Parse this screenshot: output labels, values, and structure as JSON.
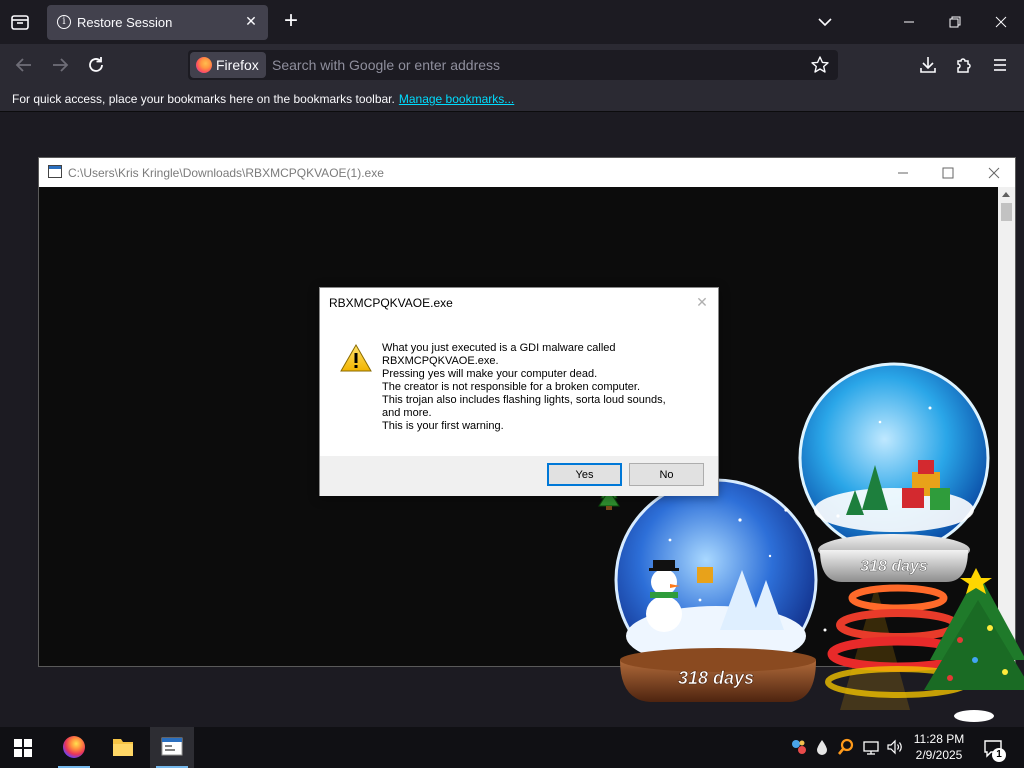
{
  "browser": {
    "tab": {
      "title": "Restore Session"
    },
    "urlbar": {
      "identity_label": "Firefox",
      "placeholder": "Search with Google or enter address"
    },
    "bookmarks_toolbar": {
      "message": "For quick access, place your bookmarks here on the bookmarks toolbar.",
      "link": "Manage bookmarks..."
    }
  },
  "console_window": {
    "title": "C:\\Users\\Kris Kringle\\Downloads\\RBXMCPQKVAOE(1).exe"
  },
  "message_box": {
    "title": "RBXMCPQKVAOE.exe",
    "lines": [
      "What you just executed is a GDI malware called",
      "RBXMCPQKVAOE.exe.",
      "Pressing yes will make your computer dead.",
      "The creator is not responsible for a broken computer.",
      "This trojan also includes flashing lights, sorta loud sounds,",
      "and more.",
      "This is your first warning."
    ],
    "yes_label": "Yes",
    "no_label": "No",
    "icon": "warning-icon"
  },
  "decoration": {
    "globe_large_label": "318 days",
    "globe_small_label": "318 days"
  },
  "taskbar": {
    "time": "11:28 PM",
    "date": "2/9/2025",
    "notification_count": "1"
  },
  "colors": {
    "firefox_dark": "#1c1b22",
    "toolbar": "#2b2a33",
    "link": "#00ddff",
    "default_button_border": "#0078d7"
  }
}
